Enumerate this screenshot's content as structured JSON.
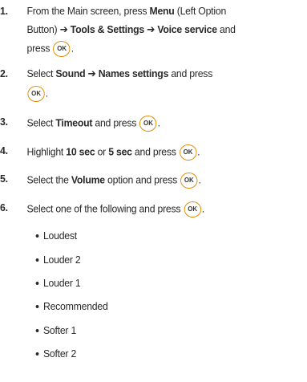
{
  "steps": [
    {
      "number": "1.",
      "line1_a": "From the Main screen, press ",
      "line1_b": "Menu",
      "line1_c": " (Left Option",
      "line2_a": "Button) ➔ ",
      "line2_b": "Tools & Settings",
      "line2_c": " ➔ ",
      "line2_d": "Voice service",
      "line2_e": " and",
      "line3_a": "press",
      "line3_end": "."
    },
    {
      "number": "2.",
      "line1_a": "Select ",
      "line1_b": "Sound",
      "line1_c": " ➔ ",
      "line1_d": "Names settings",
      "line1_e": " and press",
      "line2_end": "."
    },
    {
      "number": "3.",
      "text_a": "Select ",
      "text_b": "Timeout",
      "text_c": " and press",
      "text_end": "."
    },
    {
      "number": "4.",
      "text_a": "Highlight ",
      "text_b": "10 sec",
      "text_c": " or ",
      "text_d": "5 sec",
      "text_e": " and press",
      "text_end": "."
    },
    {
      "number": "5.",
      "text_a": "Select the ",
      "text_b": "Volume",
      "text_c": " option and press",
      "text_end": "."
    },
    {
      "number": "6.",
      "text_a": "Select one of the following and press",
      "text_end": "."
    }
  ],
  "ok_icon_label": "OK",
  "ok_icon_color": "#e08a00",
  "volume_options": [
    "Loudest",
    "Louder 2",
    "Louder 1",
    "Recommended",
    "Softer 1",
    "Softer 2"
  ]
}
